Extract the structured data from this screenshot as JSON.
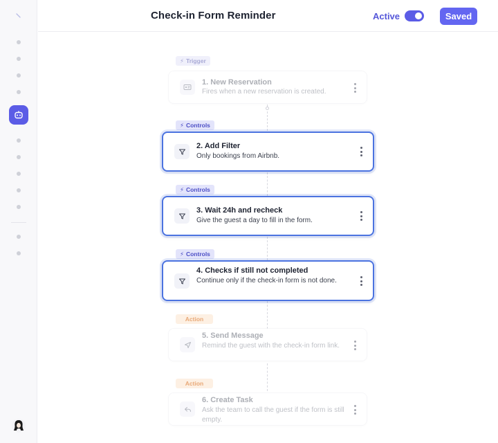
{
  "header": {
    "title": "Check-in Form Reminder",
    "active_label": "Active",
    "saved_label": "Saved"
  },
  "colors": {
    "accent": "#6366f1",
    "highlight_border": "#4b73e0",
    "trigger_badge": "#a9aad6",
    "controls_badge": "#4c4ec6",
    "action_badge": "#e8a877"
  },
  "sidebar": {
    "items": [
      "nav-item",
      "nav-item",
      "nav-item",
      "nav-item",
      "workflow-icon",
      "nav-item",
      "nav-item",
      "nav-item",
      "nav-item",
      "nav-item",
      "nav-item",
      "nav-item"
    ],
    "active_item": "workflow-icon"
  },
  "toggle": {
    "state": "on"
  },
  "steps": [
    {
      "badge": "Trigger",
      "title": "1. New Reservation",
      "desc": "Fires when a new reservation is created.",
      "icon": "id-card-icon",
      "state": "dimmed"
    },
    {
      "badge": "Controls",
      "title": "2. Add Filter",
      "desc": "Only bookings from Airbnb.",
      "icon": "filter-icon",
      "state": "highlighted"
    },
    {
      "badge": "Controls",
      "title": "3. Wait 24h and recheck",
      "desc": "Give the guest a day to fill in the form.",
      "icon": "filter-icon",
      "state": "highlighted"
    },
    {
      "badge": "Controls",
      "title": "4. Checks if still not completed",
      "desc": "Continue only if the check-in form is not done.",
      "icon": "filter-icon",
      "state": "highlighted"
    },
    {
      "badge": "Action",
      "title": "5. Send Message",
      "desc": "Remind the guest with the check-in form link.",
      "icon": "send-icon",
      "state": "dimmed"
    },
    {
      "badge": "Action",
      "title": "6. Create Task",
      "desc": "Ask the team to call the guest if the form is still empty.",
      "icon": "reply-icon",
      "state": "dimmed"
    }
  ]
}
